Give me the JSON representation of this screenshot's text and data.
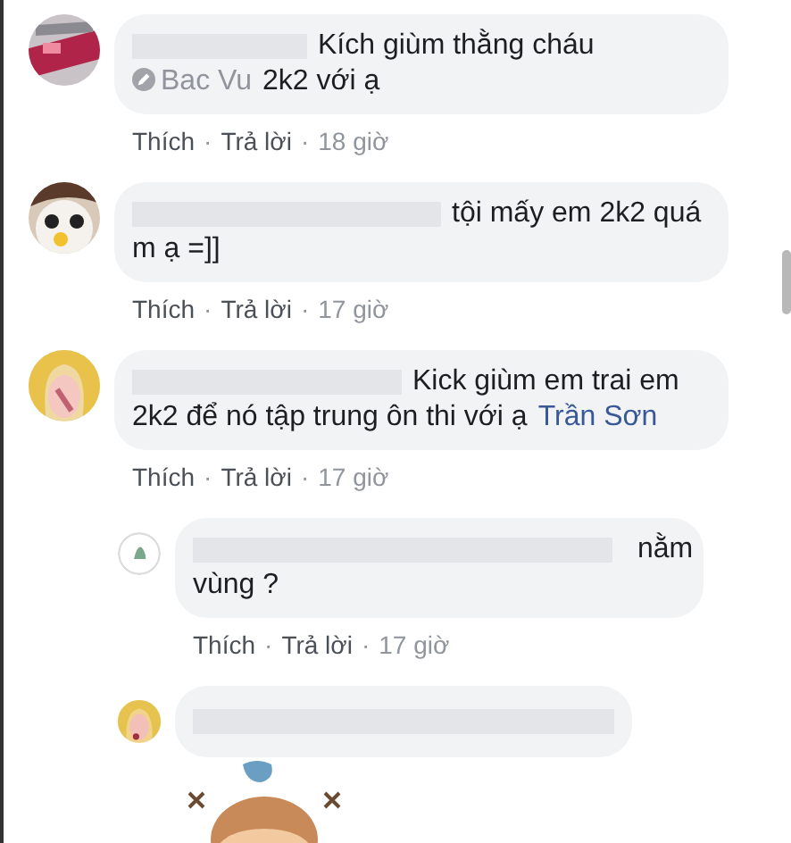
{
  "separator": "·",
  "comments": [
    {
      "avatar": {
        "kind": "picture"
      },
      "lines": [
        [
          {
            "kind": "text",
            "text": "Kích giùm thằng cháu"
          }
        ],
        [
          {
            "kind": "removed_tag",
            "text": "Bac Vu"
          },
          {
            "kind": "text",
            "text": "2k2 với ạ"
          }
        ]
      ],
      "actions": [
        "Thích",
        "Trả lời"
      ],
      "time": "18 giờ"
    },
    {
      "avatar": {
        "kind": "picture"
      },
      "lines": [
        [
          {
            "kind": "text",
            "text": "tội mấy em 2k2 quá"
          }
        ],
        [
          {
            "kind": "text",
            "text": "m ạ =]]"
          }
        ]
      ],
      "actions": [
        "Thích",
        "Trả lời"
      ],
      "time": "17 giờ"
    },
    {
      "avatar": {
        "kind": "picture"
      },
      "lines": [
        [
          {
            "kind": "text",
            "text": "Kick giùm em trai em"
          }
        ],
        [
          {
            "kind": "text",
            "text": "2k2 để nó tập trung ôn thi với ạ"
          },
          {
            "kind": "tag",
            "text": "Trần Sơn"
          }
        ]
      ],
      "actions": [
        "Thích",
        "Trả lời"
      ],
      "time": "17 giờ",
      "replies": [
        {
          "avatar": {
            "kind": "picture"
          },
          "lines": [
            [
              {
                "kind": "text",
                "text": "nằm"
              }
            ],
            [
              {
                "kind": "text",
                "text": "vùng ?"
              }
            ]
          ],
          "actions": [
            "Thích",
            "Trả lời"
          ],
          "time": "17 giờ"
        },
        {
          "avatar": {
            "kind": "picture"
          },
          "sticker": {
            "kind": "picture"
          }
        }
      ]
    }
  ]
}
